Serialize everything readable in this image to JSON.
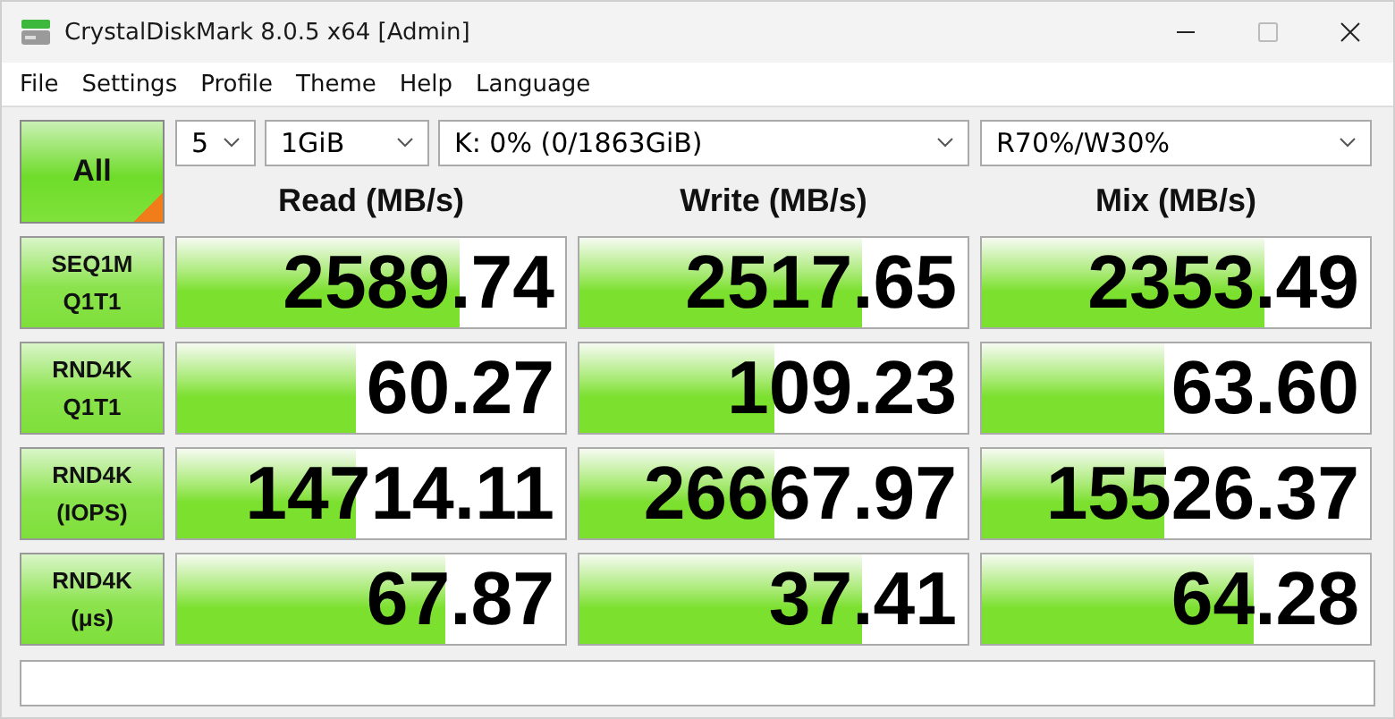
{
  "window": {
    "title": "CrystalDiskMark 8.0.5 x64 [Admin]"
  },
  "menu": [
    "File",
    "Settings",
    "Profile",
    "Theme",
    "Help",
    "Language"
  ],
  "all_button": {
    "label": "All"
  },
  "selectors": {
    "count": "5",
    "size": "1GiB",
    "drive": "K: 0% (0/1863GiB)",
    "mix_ratio": "R70%/W30%"
  },
  "columns": [
    "Read (MB/s)",
    "Write (MB/s)",
    "Mix (MB/s)"
  ],
  "rows": [
    {
      "test": [
        "SEQ1M",
        "Q1T1"
      ],
      "cells": [
        {
          "value": "2589.74",
          "level": 0.73
        },
        {
          "value": "2517.65",
          "level": 0.73
        },
        {
          "value": "2353.49",
          "level": 0.73
        }
      ]
    },
    {
      "test": [
        "RND4K",
        "Q1T1"
      ],
      "cells": [
        {
          "value": "60.27",
          "level": 0.46
        },
        {
          "value": "109.23",
          "level": 0.5
        },
        {
          "value": "63.60",
          "level": 0.47
        }
      ]
    },
    {
      "test": [
        "RND4K",
        "(IOPS)"
      ],
      "cells": [
        {
          "value": "14714.11",
          "level": 0.46
        },
        {
          "value": "26667.97",
          "level": 0.5
        },
        {
          "value": "15526.37",
          "level": 0.47
        }
      ]
    },
    {
      "test": [
        "RND4K",
        "(μs)"
      ],
      "cells": [
        {
          "value": "67.87",
          "level": 0.69
        },
        {
          "value": "37.41",
          "level": 0.73
        },
        {
          "value": "64.28",
          "level": 0.7
        }
      ]
    }
  ]
}
